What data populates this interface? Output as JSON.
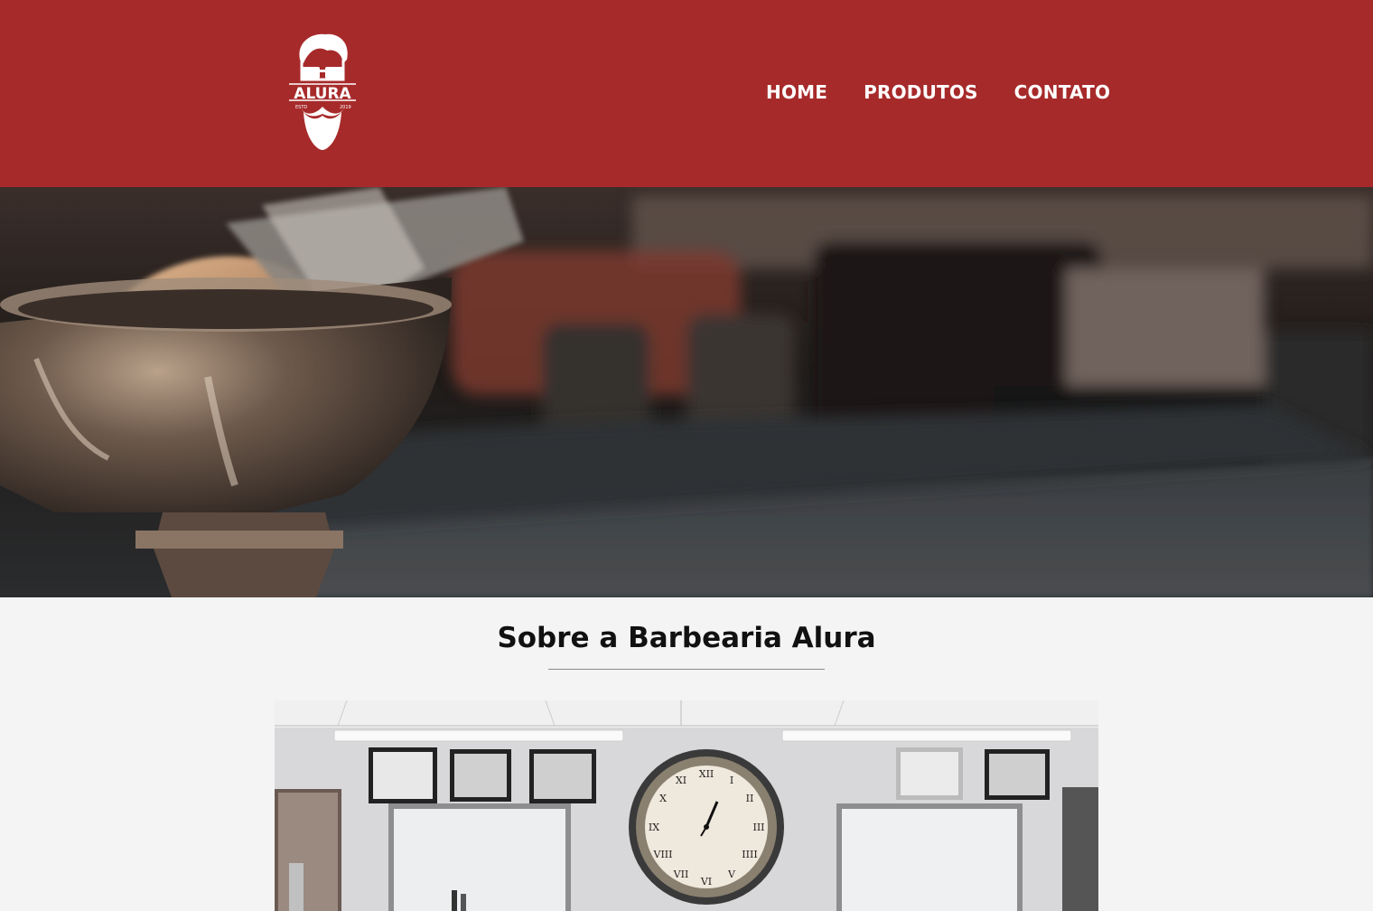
{
  "header": {
    "logo": {
      "brand": "ALURA",
      "estd_left": "ESTD",
      "estd_right": "2019",
      "icon": "bearded-man-with-glasses-logo"
    },
    "nav": [
      {
        "label": "HOME"
      },
      {
        "label": "PRODUTOS"
      },
      {
        "label": "CONTATO"
      }
    ]
  },
  "hero": {
    "image": "shaving-bowl-and-brush-photo"
  },
  "about": {
    "title": "Sobre a Barbearia Alura",
    "image": "barbershop-interior-photo",
    "clock": {
      "numerals": [
        "XII",
        "I",
        "II",
        "III",
        "IIII",
        "V",
        "VI",
        "VII",
        "VIII",
        "IX",
        "X",
        "XI"
      ]
    }
  },
  "colors": {
    "header_bg": "#a72a2a",
    "page_bg": "#f4f4f4",
    "nav_text": "#ffffff",
    "title_text": "#111111"
  }
}
